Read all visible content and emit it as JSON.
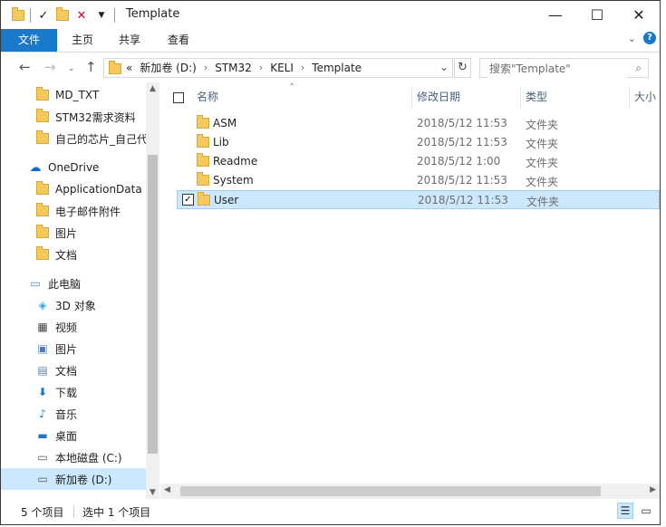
{
  "window": {
    "title": "Template"
  },
  "ribbon": {
    "tabs": [
      "文件",
      "主页",
      "共享",
      "查看"
    ]
  },
  "address": {
    "overflow": "«",
    "crumbs": [
      "新加卷 (D:)",
      "STM32",
      "KELI",
      "Template"
    ]
  },
  "search": {
    "placeholder": "搜索\"Template\""
  },
  "nav": {
    "items": [
      {
        "label": "MD_TXT",
        "icon": "folder-icon"
      },
      {
        "label": "STM32需求资料",
        "icon": "folder-icon"
      },
      {
        "label": "自己的芯片_自己代",
        "icon": "folder-icon"
      },
      {
        "label": "OneDrive",
        "icon": "onedrive-icon"
      },
      {
        "label": "ApplicationData",
        "icon": "folder-icon"
      },
      {
        "label": "电子邮件附件",
        "icon": "folder-icon"
      },
      {
        "label": "图片",
        "icon": "folder-icon"
      },
      {
        "label": "文档",
        "icon": "folder-icon"
      },
      {
        "label": "此电脑",
        "icon": "computer-icon"
      },
      {
        "label": "3D 对象",
        "icon": "3d-objects-icon"
      },
      {
        "label": "视频",
        "icon": "video-icon"
      },
      {
        "label": "图片",
        "icon": "pictures-icon"
      },
      {
        "label": "文档",
        "icon": "documents-icon"
      },
      {
        "label": "下载",
        "icon": "download-icon"
      },
      {
        "label": "音乐",
        "icon": "music-icon"
      },
      {
        "label": "桌面",
        "icon": "desktop-icon"
      },
      {
        "label": "本地磁盘 (C:)",
        "icon": "drive-icon"
      },
      {
        "label": "新加卷 (D:)",
        "icon": "drive-icon"
      }
    ],
    "selected": "新加卷 (D:)"
  },
  "columns": {
    "name": "名称",
    "date": "修改日期",
    "type": "类型",
    "size": "大小"
  },
  "files": [
    {
      "name": "ASM",
      "date": "2018/5/12 11:53",
      "type": "文件夹",
      "selected": false
    },
    {
      "name": "Lib",
      "date": "2018/5/12 11:53",
      "type": "文件夹",
      "selected": false
    },
    {
      "name": "Readme",
      "date": "2018/5/12 1:00",
      "type": "文件夹",
      "selected": false
    },
    {
      "name": "System",
      "date": "2018/5/12 11:53",
      "type": "文件夹",
      "selected": false
    },
    {
      "name": "User",
      "date": "2018/5/12 11:53",
      "type": "文件夹",
      "selected": true
    }
  ],
  "status": {
    "item_count": "5 个项目",
    "selected_count": "选中 1 个项目"
  },
  "colors": {
    "accent": "#1979ca",
    "selection": "#cce8ff",
    "folder": "#f6c95c"
  }
}
